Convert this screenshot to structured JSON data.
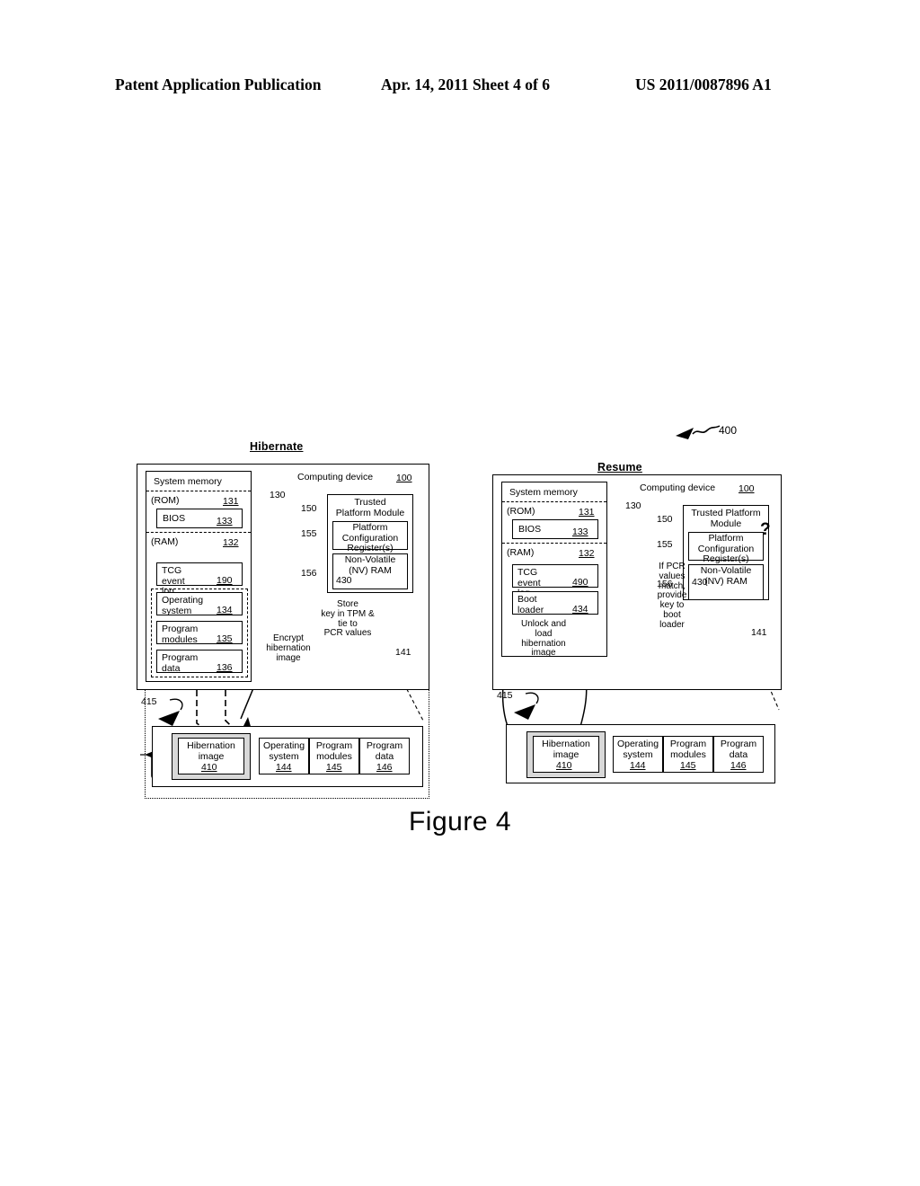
{
  "header": {
    "left": "Patent Application Publication",
    "middle": "Apr. 14, 2011  Sheet 4 of 6",
    "right": "US 2011/0087896 A1"
  },
  "figure": {
    "caption": "Figure 4",
    "overall_ref": "400"
  },
  "hibernate": {
    "title": "Hibernate",
    "device_label": "Computing device",
    "device_num": "100",
    "system_memory_label": "System memory",
    "system_memory_ref": "130",
    "rom_label": "(ROM)",
    "rom_num": "131",
    "bios_label": "BIOS",
    "bios_num": "133",
    "ram_label": "(RAM)",
    "ram_num": "132",
    "tcg_label": "TCG event\nlog",
    "tcg_num": "190",
    "os_label": "Operating\nsystem",
    "os_num": "134",
    "modules_label": "Program\nmodules",
    "modules_num": "135",
    "data_label": "Program\ndata",
    "data_num": "136",
    "tpm_label": "Trusted\nPlatform Module",
    "tpm_ref": "150",
    "pcr_label": "Platform\nConfiguration\nRegister(s)",
    "pcr_ref": "155",
    "nvram_label": "Non-Volatile\n(NV) RAM",
    "nvram_ref": "156",
    "key_num": "430",
    "annotation_store": "Store\nkey in TPM &\ntie to\nPCR values",
    "annotation_encrypt": "Encrypt\nhibernation\nimage",
    "drive_ref": "141",
    "lock_ref": "415",
    "storage": {
      "hibernation_label": "Hibernation\nimage",
      "hibernation_num": "410",
      "items": [
        {
          "label": "Operating\nsystem",
          "num": "144"
        },
        {
          "label": "Program\nmodules",
          "num": "145"
        },
        {
          "label": "Program\ndata",
          "num": "146"
        }
      ]
    }
  },
  "resume": {
    "title": "Resume",
    "device_label": "Computing device",
    "device_num": "100",
    "system_memory_label": "System memory",
    "system_memory_ref": "130",
    "rom_label": "(ROM)",
    "rom_num": "131",
    "bios_label": "BIOS",
    "bios_num": "133",
    "ram_label": "(RAM)",
    "ram_num": "132",
    "tcg_label": "TCG event\nlog",
    "tcg_num": "490",
    "boot_label": "Boot\nloader",
    "boot_num": "434",
    "tpm_label": "Trusted Platform\nModule",
    "tpm_ref": "150",
    "pcr_label": "Platform\nConfiguration\nRegister(s)",
    "pcr_ref": "155",
    "nvram_label": "Non-Volatile\n(NV) RAM",
    "nvram_ref": "156",
    "key_num": "430",
    "question_mark": "?",
    "annotation_ifpcr": "If PCR\nvalues\nmatch,\nprovide\nkey to\nboot\nloader",
    "annotation_unlock": "Unlock and\nload\nhibernation\nimage",
    "drive_ref": "141",
    "lock_ref": "415",
    "storage": {
      "hibernation_label": "Hibernation\nimage",
      "hibernation_num": "410",
      "items": [
        {
          "label": "Operating\nsystem",
          "num": "144"
        },
        {
          "label": "Program\nmodules",
          "num": "145"
        },
        {
          "label": "Program\ndata",
          "num": "146"
        }
      ]
    }
  }
}
